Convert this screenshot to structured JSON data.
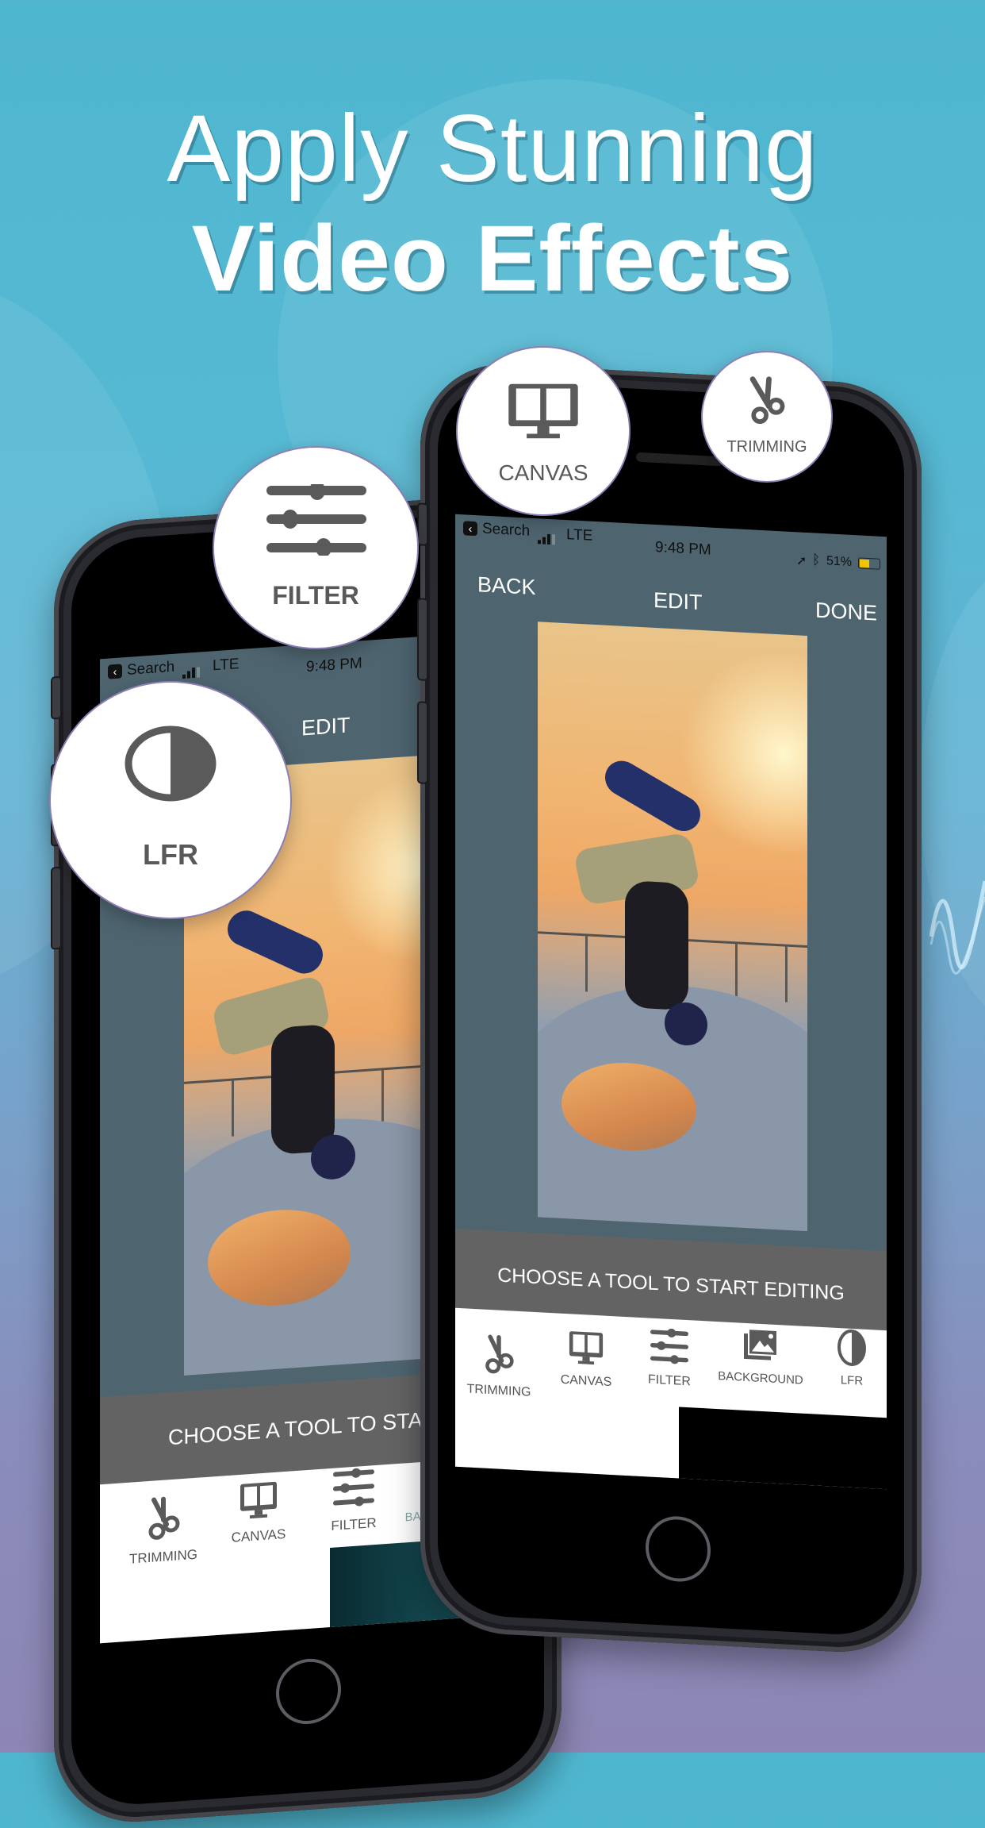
{
  "headline": {
    "line1": "Apply Stunning",
    "line2": "Video Effects"
  },
  "colors": {
    "background_top": "#4fb6cf",
    "background_bottom": "#8d86b4",
    "screen_bg": "#4e6570",
    "prompt_bar": "#636363",
    "icon_gray": "#5a5a5a",
    "bubble_border": "#8d7fb4",
    "battery": "#f5c400"
  },
  "feature_bubbles": [
    {
      "id": "canvas",
      "label": "CANVAS",
      "icon": "monitor-split-icon"
    },
    {
      "id": "trimming",
      "label": "TRIMMING",
      "icon": "scissors-icon"
    },
    {
      "id": "filter",
      "label": "FILTER",
      "icon": "sliders-icon"
    },
    {
      "id": "lfr",
      "label": "LFR",
      "icon": "half-circle-contrast-icon"
    }
  ],
  "right_phone": {
    "status_bar": {
      "back_app": "Search",
      "carrier": "LTE",
      "time": "9:48 PM",
      "battery": "51%"
    },
    "nav": {
      "back": "BACK",
      "title": "EDIT",
      "done": "DONE"
    },
    "prompt": "CHOOSE A TOOL TO START EDITING",
    "tools": [
      {
        "label": "TRIMMING",
        "icon": "scissors-icon"
      },
      {
        "label": "CANVAS",
        "icon": "monitor-split-icon"
      },
      {
        "label": "FILTER",
        "icon": "sliders-icon"
      },
      {
        "label": "BACKGROUND",
        "icon": "image-stack-icon"
      },
      {
        "label": "LFR",
        "icon": "half-circle-contrast-icon"
      }
    ]
  },
  "left_phone": {
    "status_bar": {
      "back_app": "Search",
      "carrier": "LTE",
      "time": "9:48 PM"
    },
    "nav": {
      "title": "EDIT"
    },
    "prompt": "CHOOSE A TOOL TO START E",
    "tools": [
      {
        "label": "TRIMMING",
        "icon": "scissors-icon"
      },
      {
        "label": "CANVAS",
        "icon": "monitor-split-icon"
      },
      {
        "label": "FILTER",
        "icon": "sliders-icon"
      },
      {
        "label": "BAC",
        "icon": "image-stack-icon"
      }
    ]
  }
}
